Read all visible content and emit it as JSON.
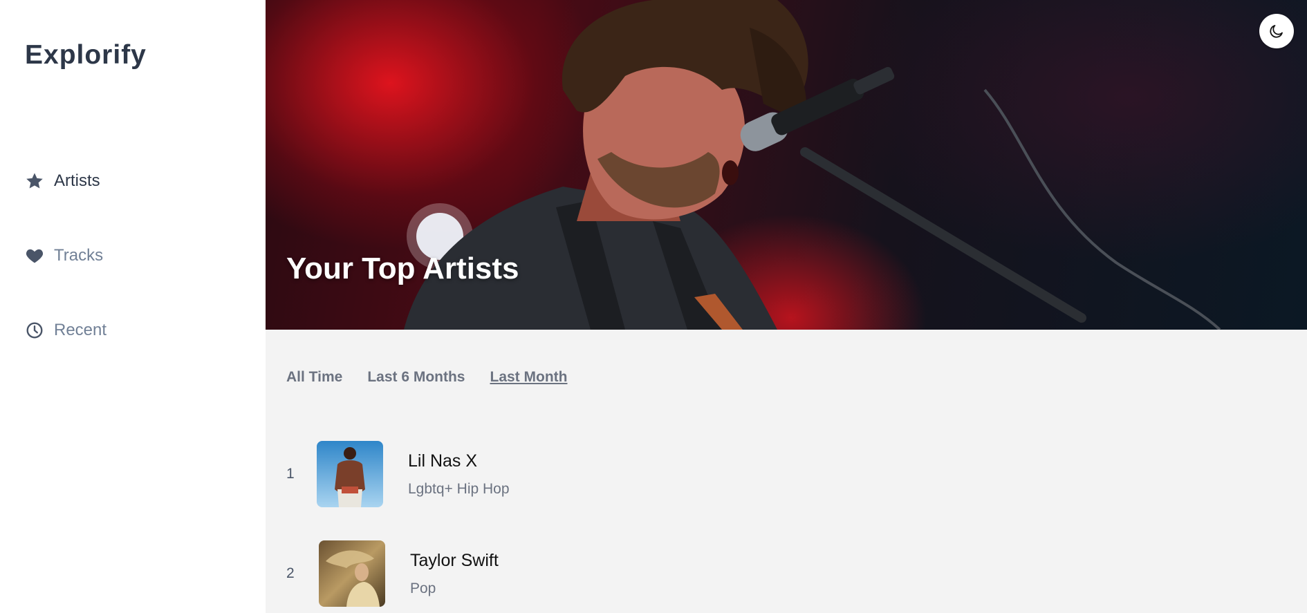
{
  "app": {
    "name": "Explorify"
  },
  "sidebar": {
    "items": [
      {
        "label": "Artists",
        "icon": "star-icon",
        "active": true
      },
      {
        "label": "Tracks",
        "icon": "heart-icon",
        "active": false
      },
      {
        "label": "Recent",
        "icon": "clock-icon",
        "active": false
      }
    ]
  },
  "hero": {
    "title": "Your Top Artists",
    "theme_toggle_icon": "moon-icon"
  },
  "filters": [
    {
      "label": "All Time",
      "active": false
    },
    {
      "label": "Last 6 Months",
      "active": false
    },
    {
      "label": "Last Month",
      "active": true
    }
  ],
  "artists": [
    {
      "rank": "1",
      "name": "Lil Nas X",
      "genre": "Lgbtq+ Hip Hop"
    },
    {
      "rank": "2",
      "name": "Taylor Swift",
      "genre": "Pop"
    }
  ],
  "colors": {
    "brand_text": "#2d3748",
    "muted_text": "#6b7280",
    "page_bg": "#f3f3f3",
    "hero_accent": "#e0141e"
  }
}
